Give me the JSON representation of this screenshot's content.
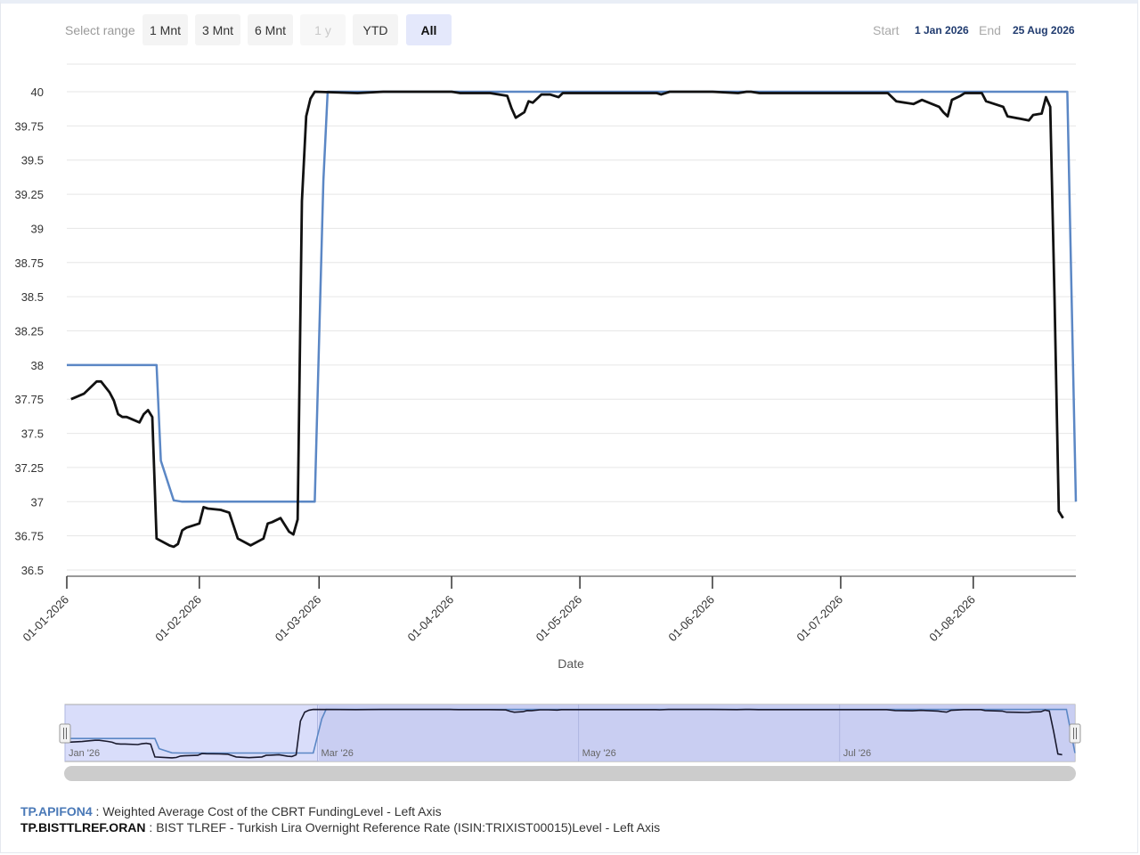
{
  "range_selector": {
    "label": "Select range",
    "buttons": [
      {
        "label": "1 Mnt",
        "state": "normal"
      },
      {
        "label": "3 Mnt",
        "state": "normal"
      },
      {
        "label": "6 Mnt",
        "state": "normal"
      },
      {
        "label": "1 y",
        "state": "disabled"
      },
      {
        "label": "YTD",
        "state": "normal"
      },
      {
        "label": "All",
        "state": "active"
      }
    ]
  },
  "date_range": {
    "start_label": "Start",
    "start_value": "1 Jan 2026",
    "end_label": "End",
    "end_value": "25 Aug 2026"
  },
  "legend": [
    {
      "code": "TP.APIFON4",
      "description": " : Weighted Average Cost of the CBRT FundingLevel - Left Axis"
    },
    {
      "code": "TP.BISTTLREF.ORAN",
      "description": " : BIST TLREF - Turkish Lira Overnight Reference Rate (ISIN:TRIXIST00015)Level - Left Axis"
    }
  ],
  "chart_data": {
    "type": "line",
    "title": "",
    "xlabel": "Date",
    "ylabel": "",
    "ylim": [
      36.5,
      40
    ],
    "xlim": [
      "2026-01-01",
      "2026-08-25"
    ],
    "grid": true,
    "y_ticks": [
      "36.5",
      "36.75",
      "37",
      "37.25",
      "37.5",
      "37.75",
      "38",
      "38.25",
      "38.5",
      "38.75",
      "39",
      "39.25",
      "39.5",
      "39.75",
      "40"
    ],
    "x_ticks": [
      {
        "date": "2026-01-01",
        "label": "01-01-2026"
      },
      {
        "date": "2026-02-01",
        "label": "01-02-2026"
      },
      {
        "date": "2026-03-01",
        "label": "01-03-2026"
      },
      {
        "date": "2026-04-01",
        "label": "01-04-2026"
      },
      {
        "date": "2026-05-01",
        "label": "01-05-2026"
      },
      {
        "date": "2026-06-01",
        "label": "01-06-2026"
      },
      {
        "date": "2026-07-01",
        "label": "01-07-2026"
      },
      {
        "date": "2026-08-01",
        "label": "01-08-2026"
      }
    ],
    "navigator_labels": [
      {
        "date": "2026-01-01",
        "label": "Jan '26"
      },
      {
        "date": "2026-03-01",
        "label": "Mar '26"
      },
      {
        "date": "2026-05-01",
        "label": "May '26"
      },
      {
        "date": "2026-07-01",
        "label": "Jul '26"
      }
    ],
    "series": [
      {
        "name": "TP.APIFON4",
        "color": "#5b87c5",
        "points": [
          [
            "2026-01-01",
            38.0
          ],
          [
            "2026-01-22",
            38.0
          ],
          [
            "2026-01-23",
            37.3
          ],
          [
            "2026-01-26",
            37.01
          ],
          [
            "2026-01-28",
            37.0
          ],
          [
            "2026-02-28",
            37.0
          ],
          [
            "2026-03-02",
            39.35
          ],
          [
            "2026-03-03",
            40.0
          ],
          [
            "2026-08-23",
            40.0
          ],
          [
            "2026-08-25",
            37.0
          ]
        ]
      },
      {
        "name": "TP.BISTTLREF.ORAN",
        "color": "#111111",
        "points": [
          [
            "2026-01-02",
            37.75
          ],
          [
            "2026-01-05",
            37.79
          ],
          [
            "2026-01-06",
            37.82
          ],
          [
            "2026-01-08",
            37.88
          ],
          [
            "2026-01-09",
            37.88
          ],
          [
            "2026-01-11",
            37.8
          ],
          [
            "2026-01-12",
            37.74
          ],
          [
            "2026-01-13",
            37.64
          ],
          [
            "2026-01-14",
            37.62
          ],
          [
            "2026-01-15",
            37.62
          ],
          [
            "2026-01-18",
            37.58
          ],
          [
            "2026-01-19",
            37.64
          ],
          [
            "2026-01-20",
            37.67
          ],
          [
            "2026-01-21",
            37.62
          ],
          [
            "2026-01-22",
            36.73
          ],
          [
            "2026-01-25",
            36.68
          ],
          [
            "2026-01-26",
            36.67
          ],
          [
            "2026-01-27",
            36.69
          ],
          [
            "2026-01-28",
            36.79
          ],
          [
            "2026-01-29",
            36.81
          ],
          [
            "2026-02-01",
            36.84
          ],
          [
            "2026-02-02",
            36.96
          ],
          [
            "2026-02-03",
            36.95
          ],
          [
            "2026-02-06",
            36.94
          ],
          [
            "2026-02-08",
            36.92
          ],
          [
            "2026-02-10",
            36.73
          ],
          [
            "2026-02-13",
            36.68
          ],
          [
            "2026-02-16",
            36.73
          ],
          [
            "2026-02-17",
            36.84
          ],
          [
            "2026-02-18",
            36.85
          ],
          [
            "2026-02-20",
            36.88
          ],
          [
            "2026-02-22",
            36.78
          ],
          [
            "2026-02-23",
            36.76
          ],
          [
            "2026-02-24",
            36.87
          ],
          [
            "2026-02-25",
            39.2
          ],
          [
            "2026-02-26",
            39.82
          ],
          [
            "2026-02-27",
            39.95
          ],
          [
            "2026-02-28",
            40.0
          ],
          [
            "2026-03-10",
            39.99
          ],
          [
            "2026-03-16",
            40.0
          ],
          [
            "2026-03-20",
            40.0
          ],
          [
            "2026-04-01",
            40.0
          ],
          [
            "2026-04-03",
            39.99
          ],
          [
            "2026-04-10",
            39.99
          ],
          [
            "2026-04-14",
            39.97
          ],
          [
            "2026-04-15",
            39.88
          ],
          [
            "2026-04-16",
            39.81
          ],
          [
            "2026-04-18",
            39.85
          ],
          [
            "2026-04-19",
            39.93
          ],
          [
            "2026-04-20",
            39.92
          ],
          [
            "2026-04-22",
            39.98
          ],
          [
            "2026-04-24",
            39.98
          ],
          [
            "2026-04-26",
            39.96
          ],
          [
            "2026-04-27",
            39.99
          ],
          [
            "2026-05-01",
            39.99
          ],
          [
            "2026-05-10",
            39.99
          ],
          [
            "2026-05-19",
            39.99
          ],
          [
            "2026-05-20",
            39.98
          ],
          [
            "2026-05-22",
            40.0
          ],
          [
            "2026-06-01",
            40.0
          ],
          [
            "2026-06-07",
            39.99
          ],
          [
            "2026-06-09",
            40.0
          ],
          [
            "2026-06-10",
            40.0
          ],
          [
            "2026-06-12",
            39.99
          ],
          [
            "2026-06-20",
            39.99
          ],
          [
            "2026-07-01",
            39.99
          ],
          [
            "2026-07-12",
            39.99
          ],
          [
            "2026-07-14",
            39.93
          ],
          [
            "2026-07-18",
            39.91
          ],
          [
            "2026-07-20",
            39.94
          ],
          [
            "2026-07-24",
            39.89
          ],
          [
            "2026-07-25",
            39.85
          ],
          [
            "2026-07-26",
            39.82
          ],
          [
            "2026-07-27",
            39.94
          ],
          [
            "2026-07-29",
            39.97
          ],
          [
            "2026-07-30",
            39.99
          ],
          [
            "2026-08-03",
            39.99
          ],
          [
            "2026-08-04",
            39.93
          ],
          [
            "2026-08-08",
            39.89
          ],
          [
            "2026-08-09",
            39.82
          ],
          [
            "2026-08-14",
            39.79
          ],
          [
            "2026-08-15",
            39.83
          ],
          [
            "2026-08-17",
            39.84
          ],
          [
            "2026-08-18",
            39.96
          ],
          [
            "2026-08-19",
            39.89
          ],
          [
            "2026-08-20",
            38.5
          ],
          [
            "2026-08-21",
            36.93
          ],
          [
            "2026-08-22",
            36.88
          ]
        ]
      }
    ]
  }
}
